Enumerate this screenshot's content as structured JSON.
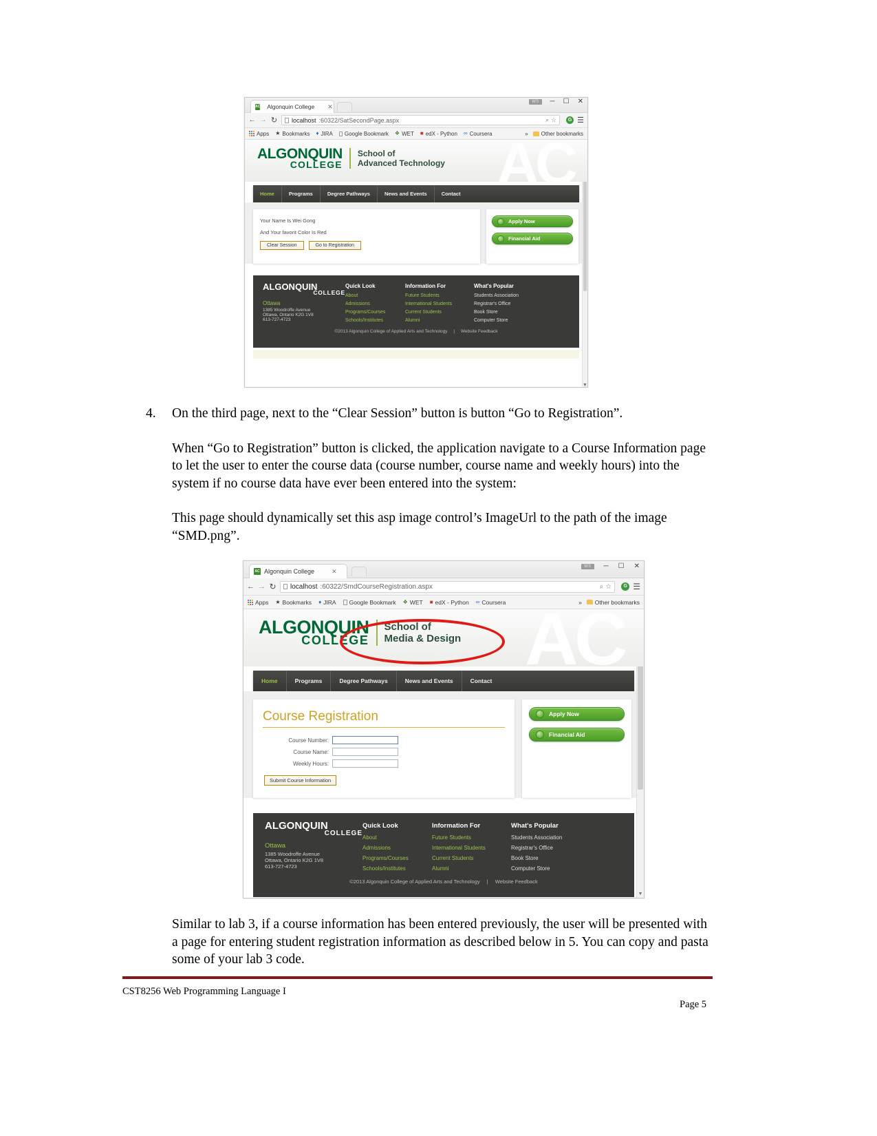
{
  "document": {
    "footer_left": "CST8256 Web Programming Language I",
    "footer_right": "Page 5",
    "paragraphs": {
      "item4_number": "4.",
      "item4_text": "On the third page, next to the “Clear Session” button is button “Go to Registration”.",
      "item4_body1": "When “Go to Registration” button is clicked, the application navigate to a Course Information page to let the user to enter the course data (course number, course name and weekly hours) into the system if no course data have ever been entered into the system:",
      "item4_body2": "This page should dynamically set this asp image control’s ImageUrl to the path of the image “SMD.png”.",
      "closing": "Similar to lab 3, if a course information has been entered previously, the user will be presented with a page for entering student registration information as described below in 5. You can copy and pasta some of your lab 3 code."
    }
  },
  "browser_chrome": {
    "tab_title": "Algonquin College",
    "tab_favicon_text": "AC",
    "tab_close": "✕",
    "ws_badge": "WS",
    "minimize": "─",
    "maximize": "☐",
    "close": "✕",
    "back_arrow": "←",
    "forward_arrow": "→",
    "reload": "↻",
    "omni_zoom_icon": "⌕",
    "omni_star_icon": "☆",
    "gplus_label": "G",
    "menu_icon": "☰",
    "bookmarks": [
      {
        "icon": "apps-grid",
        "label": "Apps"
      },
      {
        "icon": "star",
        "label": "Bookmarks"
      },
      {
        "icon": "jira",
        "label": "JIRA"
      },
      {
        "icon": "page",
        "label": "Google Bookmark"
      },
      {
        "icon": "wet",
        "label": "WET"
      },
      {
        "icon": "edx",
        "label": "edX - Python"
      },
      {
        "icon": "coursera",
        "label": "Coursera"
      }
    ],
    "overflow": "»",
    "other_bookmarks": "Other bookmarks"
  },
  "screenshot1": {
    "url_host": "localhost",
    "url_rest": ":60322/SatSecondPage.aspx",
    "brand_line1": "ALGONQUIN",
    "brand_line2": "COLLEGE",
    "school_line1": "School of",
    "school_line2": "Advanced Technology",
    "ghost_letters": "AC",
    "nav": [
      "Home",
      "Programs",
      "Degree Pathways",
      "News and Events",
      "Contact"
    ],
    "nav_active": "Home",
    "content": {
      "line1": "Your Name Is Wei Gong",
      "line2": "And Your favorit Color Is Red",
      "button_clear": "Clear Session",
      "button_goto": "Go to Registration"
    },
    "sidebar_buttons": [
      "Apply Now",
      "Financial Aid"
    ],
    "footer": {
      "brand_line1": "ALGONQUIN",
      "brand_line2": "COLLEGE",
      "city": "Ottawa",
      "address1": "1385 Woodroffe Avenue",
      "address2": "Ottawa, Ontario K2G 1V8",
      "phone": "613-727-4723",
      "columns": [
        {
          "head": "Quick Look",
          "links": [
            "About",
            "Admissions",
            "Programs/Courses",
            "Schools/Institutes"
          ]
        },
        {
          "head": "Information For",
          "links": [
            "Future Students",
            "International Students",
            "Current Students",
            "Alumni"
          ]
        },
        {
          "head": "What's Popular",
          "links": [
            "Students Association",
            "Registrar's Office",
            "Book Store",
            "Computer Store"
          ]
        }
      ],
      "copyright": "©2013 Algonquin College of Applied Arts and Technology",
      "copyright_sep": "|",
      "feedback": "Website Feedback"
    }
  },
  "screenshot2": {
    "url_host": "localhost",
    "url_rest": ":60322/SmdCourseRegistration.aspx",
    "brand_line1": "ALGONQUIN",
    "brand_line2": "COLLEGE",
    "school_line1": "School of",
    "school_line2": "Media & Design",
    "ghost_letters": "AC",
    "nav": [
      "Home",
      "Programs",
      "Degree Pathways",
      "News and Events",
      "Contact"
    ],
    "nav_active": "Home",
    "annotation": {
      "shape": "red-ellipse",
      "color": "#e01b17"
    },
    "content": {
      "title": "Course Registration",
      "fields": [
        {
          "label": "Course Number:",
          "value": "",
          "focused": true
        },
        {
          "label": "Course Name:",
          "value": "",
          "focused": false
        },
        {
          "label": "Weekly Hours:",
          "value": "",
          "focused": false
        }
      ],
      "submit_button": "Submit Course Information"
    },
    "sidebar_buttons": [
      "Apply Now",
      "Financial Aid"
    ],
    "footer": {
      "brand_line1": "ALGONQUIN",
      "brand_line2": "COLLEGE",
      "city": "Ottawa",
      "address1": "1385 Woodroffe Avenue",
      "address2": "Ottawa, Ontario K2G 1V8",
      "phone": "613-727-4723",
      "columns": [
        {
          "head": "Quick Look",
          "links": [
            "About",
            "Admissions",
            "Programs/Courses",
            "Schools/Institutes"
          ]
        },
        {
          "head": "Information For",
          "links": [
            "Future Students",
            "International Students",
            "Current Students",
            "Alumni"
          ]
        },
        {
          "head": "What's Popular",
          "links": [
            "Students Association",
            "Registrar's Office",
            "Book Store",
            "Computer Store"
          ]
        }
      ],
      "copyright": "©2013 Algonquin College of Applied Arts and Technology",
      "copyright_sep": "|",
      "feedback": "Website Feedback"
    }
  },
  "colors": {
    "brand_green": "#006837",
    "accent_green": "#9bc24a",
    "annotation_red": "#e01b17",
    "title_gold": "#c9a227",
    "footer_dark": "#3a3a38",
    "rule_maroon": "#7b1b1b"
  }
}
